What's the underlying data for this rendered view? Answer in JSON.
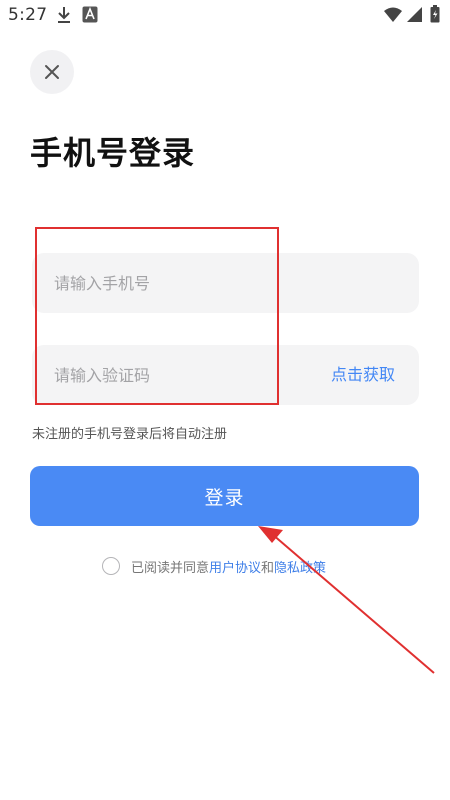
{
  "status_bar": {
    "time": "5:27",
    "icons": [
      "download-icon",
      "app-notification-icon",
      "wifi-icon",
      "signal-icon",
      "battery-icon"
    ]
  },
  "close_icon": "close-icon",
  "title": "手机号登录",
  "phone_field": {
    "placeholder": "请输入手机号",
    "value": ""
  },
  "code_field": {
    "placeholder": "请输入验证码",
    "value": "",
    "get_code_label": "点击获取"
  },
  "hint": "未注册的手机号登录后将自动注册",
  "login_button": "登录",
  "agreement": {
    "prefix": "已阅读并同意",
    "user_agreement": "用户协议",
    "and": "和",
    "privacy_policy": "隐私政策",
    "checked": false
  },
  "colors": {
    "accent": "#4a8af4",
    "link": "#3f7fe8",
    "annotation": "#e03030",
    "field_background": "#f4f4f5"
  }
}
